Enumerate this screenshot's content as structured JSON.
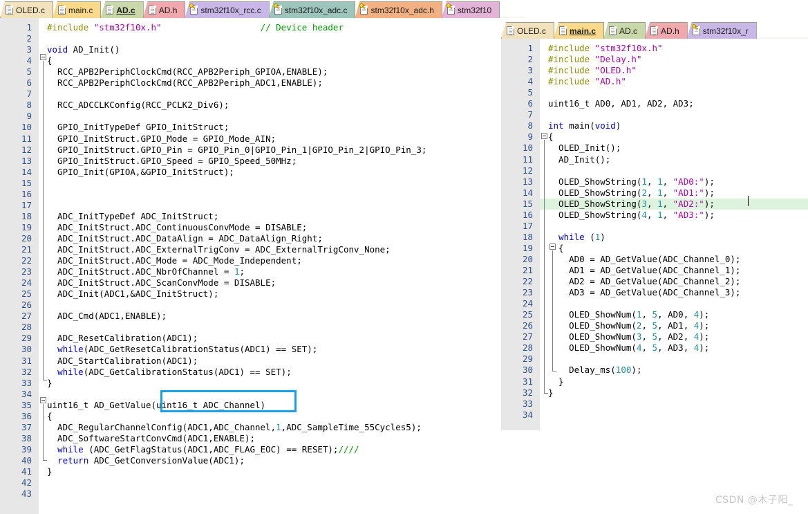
{
  "app": {
    "watermark": "CSDN @木子阳_"
  },
  "left_panel": {
    "tabs": [
      {
        "label": "OLED.c",
        "icon": "file-icon",
        "color": "#f2e2bb",
        "active": false
      },
      {
        "label": "main.c",
        "icon": "file-icon",
        "color": "#fbd98a",
        "active": false
      },
      {
        "label": "AD.c",
        "icon": "file-icon",
        "color": "#c9d8a8",
        "active": true
      },
      {
        "label": "AD.h",
        "icon": "file-icon",
        "color": "#f0a8ac",
        "active": false
      },
      {
        "label": "stm32f10x_rcc.c",
        "icon": "file-key-icon",
        "color": "#c9b7e8",
        "active": false
      },
      {
        "label": "stm32f10x_adc.c",
        "icon": "file-key-icon",
        "color": "#9ec5bb",
        "active": false
      },
      {
        "label": "stm32f10x_adc.h",
        "icon": "file-key-icon",
        "color": "#f2b183",
        "active": false
      },
      {
        "label": "stm32f10",
        "icon": "file-key-icon",
        "color": "#e3b4d8",
        "active": false
      }
    ],
    "lines": [
      {
        "n": "1",
        "tokens": [
          {
            "t": "#include ",
            "c": "pp"
          },
          {
            "t": "\"stm32f10x.h\"",
            "c": "str"
          },
          {
            "t": "                   ",
            "c": "pl"
          },
          {
            "t": "// Device header",
            "c": "cmt"
          }
        ]
      },
      {
        "n": "2",
        "tokens": []
      },
      {
        "n": "3",
        "tokens": [
          {
            "t": "void",
            "c": "kw"
          },
          {
            "t": " AD_Init()",
            "c": "pl"
          }
        ]
      },
      {
        "n": "4",
        "tokens": [
          {
            "t": "{",
            "c": "pl"
          }
        ]
      },
      {
        "n": "5",
        "tokens": [
          {
            "t": "  RCC_APB2PeriphClockCmd(RCC_APB2Periph_GPIOA,ENABLE);",
            "c": "pl"
          }
        ]
      },
      {
        "n": "6",
        "tokens": [
          {
            "t": "  RCC_APB2PeriphClockCmd(RCC_APB2Periph_ADC1,ENABLE);",
            "c": "pl"
          }
        ]
      },
      {
        "n": "7",
        "tokens": []
      },
      {
        "n": "8",
        "tokens": [
          {
            "t": "  RCC_ADCCLKConfig(RCC_PCLK2_Div6);",
            "c": "pl"
          }
        ]
      },
      {
        "n": "9",
        "tokens": []
      },
      {
        "n": "10",
        "tokens": [
          {
            "t": "  GPIO_InitTypeDef GPIO_InitStruct;",
            "c": "pl"
          }
        ]
      },
      {
        "n": "11",
        "tokens": [
          {
            "t": "  GPIO_InitStruct.GPIO_Mode = GPIO_Mode_AIN;",
            "c": "pl"
          }
        ]
      },
      {
        "n": "12",
        "tokens": [
          {
            "t": "  GPIO_InitStruct.GPIO_Pin = GPIO_Pin_0|GPIO_Pin_1|GPIO_Pin_2|GPIO_Pin_3;",
            "c": "pl"
          }
        ]
      },
      {
        "n": "13",
        "tokens": [
          {
            "t": "  GPIO_InitStruct.GPIO_Speed = GPIO_Speed_50MHz;",
            "c": "pl"
          }
        ]
      },
      {
        "n": "14",
        "tokens": [
          {
            "t": "  GPIO_Init(GPIOA,&GPIO_InitStruct);",
            "c": "pl"
          }
        ]
      },
      {
        "n": "15",
        "tokens": []
      },
      {
        "n": "16",
        "tokens": []
      },
      {
        "n": "17",
        "tokens": []
      },
      {
        "n": "18",
        "tokens": [
          {
            "t": "  ADC_InitTypeDef ADC_InitStruct;",
            "c": "pl"
          }
        ]
      },
      {
        "n": "19",
        "tokens": [
          {
            "t": "  ADC_InitStruct.ADC_ContinuousConvMode = DISABLE;",
            "c": "pl"
          }
        ]
      },
      {
        "n": "20",
        "tokens": [
          {
            "t": "  ADC_InitStruct.ADC_DataAlign = ADC_DataAlign_Right;",
            "c": "pl"
          }
        ]
      },
      {
        "n": "21",
        "tokens": [
          {
            "t": "  ADC_InitStruct.ADC_ExternalTrigConv = ADC_ExternalTrigConv_None;",
            "c": "pl"
          }
        ]
      },
      {
        "n": "22",
        "tokens": [
          {
            "t": "  ADC_InitStruct.ADC_Mode = ADC_Mode_Independent;",
            "c": "pl"
          }
        ]
      },
      {
        "n": "23",
        "tokens": [
          {
            "t": "  ADC_InitStruct.ADC_NbrOfChannel = ",
            "c": "pl"
          },
          {
            "t": "1",
            "c": "num"
          },
          {
            "t": ";",
            "c": "pl"
          }
        ]
      },
      {
        "n": "24",
        "tokens": [
          {
            "t": "  ADC_InitStruct.ADC_ScanConvMode = DISABLE;",
            "c": "pl"
          }
        ]
      },
      {
        "n": "25",
        "tokens": [
          {
            "t": "  ADC_Init(ADC1,&ADC_InitStruct);",
            "c": "pl"
          }
        ]
      },
      {
        "n": "26",
        "tokens": []
      },
      {
        "n": "27",
        "tokens": [
          {
            "t": "  ADC_Cmd(ADC1,ENABLE);",
            "c": "pl"
          }
        ]
      },
      {
        "n": "28",
        "tokens": []
      },
      {
        "n": "29",
        "tokens": [
          {
            "t": "  ADC_ResetCalibration(ADC1);",
            "c": "pl"
          }
        ]
      },
      {
        "n": "30",
        "tokens": [
          {
            "t": "  ",
            "c": "pl"
          },
          {
            "t": "while",
            "c": "kw"
          },
          {
            "t": "(ADC_GetResetCalibrationStatus(ADC1) == SET);",
            "c": "pl"
          }
        ]
      },
      {
        "n": "31",
        "tokens": [
          {
            "t": "  ADC_StartCalibration(ADC1);",
            "c": "pl"
          }
        ]
      },
      {
        "n": "32",
        "tokens": [
          {
            "t": "  ",
            "c": "pl"
          },
          {
            "t": "while",
            "c": "kw"
          },
          {
            "t": "(ADC_GetCalibrationStatus(ADC1) == SET);",
            "c": "pl"
          }
        ]
      },
      {
        "n": "33",
        "tokens": [
          {
            "t": "}",
            "c": "pl"
          }
        ]
      },
      {
        "n": "34",
        "tokens": []
      },
      {
        "n": "35",
        "tokens": [
          {
            "t": "uint16_t AD_GetValue(uint16_t ADC_Channel)",
            "c": "pl"
          }
        ]
      },
      {
        "n": "36",
        "tokens": [
          {
            "t": "{",
            "c": "pl"
          }
        ]
      },
      {
        "n": "37",
        "tokens": [
          {
            "t": "  ADC_RegularChannelConfig(ADC1,ADC_Channel,",
            "c": "pl"
          },
          {
            "t": "1",
            "c": "num"
          },
          {
            "t": ",ADC_SampleTime_55Cycles5);",
            "c": "pl"
          }
        ]
      },
      {
        "n": "38",
        "tokens": [
          {
            "t": "  ADC_SoftwareStartConvCmd(ADC1,ENABLE);",
            "c": "pl"
          }
        ]
      },
      {
        "n": "39",
        "tokens": [
          {
            "t": "  ",
            "c": "pl"
          },
          {
            "t": "while",
            "c": "kw"
          },
          {
            "t": " (ADC_GetFlagStatus(ADC1,ADC_FLAG_EOC) == RESET);",
            "c": "pl"
          },
          {
            "t": "////",
            "c": "cmt"
          }
        ]
      },
      {
        "n": "40",
        "tokens": [
          {
            "t": "  ",
            "c": "pl"
          },
          {
            "t": "return",
            "c": "kw"
          },
          {
            "t": " ADC_GetConversionValue(ADC1);",
            "c": "pl"
          }
        ]
      },
      {
        "n": "41",
        "tokens": [
          {
            "t": "}",
            "c": "pl"
          }
        ]
      },
      {
        "n": "42",
        "tokens": []
      },
      {
        "n": "43",
        "tokens": []
      }
    ],
    "annotation": {
      "name": "parameter-highlight-box",
      "color": "#1ba1e2"
    }
  },
  "right_panel": {
    "tabs": [
      {
        "label": "OLED.c",
        "icon": "file-icon",
        "color": "#f2e2bb",
        "active": false
      },
      {
        "label": "main.c",
        "icon": "file-icon",
        "color": "#fbd98a",
        "active": true
      },
      {
        "label": "AD.c",
        "icon": "file-icon",
        "color": "#c9d8a8",
        "active": false
      },
      {
        "label": "AD.h",
        "icon": "file-icon",
        "color": "#f0a8ac",
        "active": false
      },
      {
        "label": "stm32f10x_r",
        "icon": "file-key-icon",
        "color": "#c9b7e8",
        "active": false
      }
    ],
    "highlight_line": 15,
    "highlight_color": "#ddf3dd",
    "lines": [
      {
        "n": "1",
        "tokens": [
          {
            "t": "#include ",
            "c": "pp"
          },
          {
            "t": "\"stm32f10x.h\"",
            "c": "str"
          }
        ]
      },
      {
        "n": "2",
        "tokens": [
          {
            "t": "#include ",
            "c": "pp"
          },
          {
            "t": "\"Delay.h\"",
            "c": "str"
          }
        ]
      },
      {
        "n": "3",
        "tokens": [
          {
            "t": "#include ",
            "c": "pp"
          },
          {
            "t": "\"OLED.h\"",
            "c": "str"
          }
        ]
      },
      {
        "n": "4",
        "tokens": [
          {
            "t": "#include ",
            "c": "pp"
          },
          {
            "t": "\"AD.h\"",
            "c": "str"
          }
        ]
      },
      {
        "n": "5",
        "tokens": []
      },
      {
        "n": "6",
        "tokens": [
          {
            "t": "uint16_t AD0, AD1, AD2, AD3;",
            "c": "pl"
          }
        ]
      },
      {
        "n": "7",
        "tokens": []
      },
      {
        "n": "8",
        "tokens": [
          {
            "t": "int",
            "c": "kw"
          },
          {
            "t": " main(",
            "c": "pl"
          },
          {
            "t": "void",
            "c": "kw"
          },
          {
            "t": ")",
            "c": "pl"
          }
        ]
      },
      {
        "n": "9",
        "tokens": [
          {
            "t": "{",
            "c": "pl"
          }
        ]
      },
      {
        "n": "10",
        "tokens": [
          {
            "t": "  OLED_Init();",
            "c": "pl"
          }
        ]
      },
      {
        "n": "11",
        "tokens": [
          {
            "t": "  AD_Init();",
            "c": "pl"
          }
        ]
      },
      {
        "n": "12",
        "tokens": []
      },
      {
        "n": "13",
        "tokens": [
          {
            "t": "  OLED_ShowString(",
            "c": "pl"
          },
          {
            "t": "1",
            "c": "num"
          },
          {
            "t": ", ",
            "c": "pl"
          },
          {
            "t": "1",
            "c": "num"
          },
          {
            "t": ", ",
            "c": "pl"
          },
          {
            "t": "\"AD0:\"",
            "c": "str"
          },
          {
            "t": ");",
            "c": "pl"
          }
        ]
      },
      {
        "n": "14",
        "tokens": [
          {
            "t": "  OLED_ShowString(",
            "c": "pl"
          },
          {
            "t": "2",
            "c": "num"
          },
          {
            "t": ", ",
            "c": "pl"
          },
          {
            "t": "1",
            "c": "num"
          },
          {
            "t": ", ",
            "c": "pl"
          },
          {
            "t": "\"AD1:\"",
            "c": "str"
          },
          {
            "t": ");",
            "c": "pl"
          }
        ]
      },
      {
        "n": "15",
        "tokens": [
          {
            "t": "  OLED_ShowString(",
            "c": "pl"
          },
          {
            "t": "3",
            "c": "num"
          },
          {
            "t": ", ",
            "c": "pl"
          },
          {
            "t": "1",
            "c": "num"
          },
          {
            "t": ", ",
            "c": "pl"
          },
          {
            "t": "\"AD2:\"",
            "c": "str"
          },
          {
            "t": ");",
            "c": "pl"
          }
        ]
      },
      {
        "n": "16",
        "tokens": [
          {
            "t": "  OLED_ShowString(",
            "c": "pl"
          },
          {
            "t": "4",
            "c": "num"
          },
          {
            "t": ", ",
            "c": "pl"
          },
          {
            "t": "1",
            "c": "num"
          },
          {
            "t": ", ",
            "c": "pl"
          },
          {
            "t": "\"AD3:\"",
            "c": "str"
          },
          {
            "t": ");",
            "c": "pl"
          }
        ]
      },
      {
        "n": "17",
        "tokens": []
      },
      {
        "n": "18",
        "tokens": [
          {
            "t": "  ",
            "c": "pl"
          },
          {
            "t": "while",
            "c": "kw"
          },
          {
            "t": " (",
            "c": "pl"
          },
          {
            "t": "1",
            "c": "num"
          },
          {
            "t": ")",
            "c": "pl"
          }
        ]
      },
      {
        "n": "19",
        "tokens": [
          {
            "t": "  {",
            "c": "pl"
          }
        ]
      },
      {
        "n": "20",
        "tokens": [
          {
            "t": "    AD0 = AD_GetValue(ADC_Channel_0);",
            "c": "pl"
          }
        ]
      },
      {
        "n": "21",
        "tokens": [
          {
            "t": "    AD1 = AD_GetValue(ADC_Channel_1);",
            "c": "pl"
          }
        ]
      },
      {
        "n": "22",
        "tokens": [
          {
            "t": "    AD2 = AD_GetValue(ADC_Channel_2);",
            "c": "pl"
          }
        ]
      },
      {
        "n": "23",
        "tokens": [
          {
            "t": "    AD3 = AD_GetValue(ADC_Channel_3);",
            "c": "pl"
          }
        ]
      },
      {
        "n": "24",
        "tokens": []
      },
      {
        "n": "25",
        "tokens": [
          {
            "t": "    OLED_ShowNum(",
            "c": "pl"
          },
          {
            "t": "1",
            "c": "num"
          },
          {
            "t": ", ",
            "c": "pl"
          },
          {
            "t": "5",
            "c": "num"
          },
          {
            "t": ", AD0, ",
            "c": "pl"
          },
          {
            "t": "4",
            "c": "num"
          },
          {
            "t": ");",
            "c": "pl"
          }
        ]
      },
      {
        "n": "26",
        "tokens": [
          {
            "t": "    OLED_ShowNum(",
            "c": "pl"
          },
          {
            "t": "2",
            "c": "num"
          },
          {
            "t": ", ",
            "c": "pl"
          },
          {
            "t": "5",
            "c": "num"
          },
          {
            "t": ", AD1, ",
            "c": "pl"
          },
          {
            "t": "4",
            "c": "num"
          },
          {
            "t": ");",
            "c": "pl"
          }
        ]
      },
      {
        "n": "27",
        "tokens": [
          {
            "t": "    OLED_ShowNum(",
            "c": "pl"
          },
          {
            "t": "3",
            "c": "num"
          },
          {
            "t": ", ",
            "c": "pl"
          },
          {
            "t": "5",
            "c": "num"
          },
          {
            "t": ", AD2, ",
            "c": "pl"
          },
          {
            "t": "4",
            "c": "num"
          },
          {
            "t": ");",
            "c": "pl"
          }
        ]
      },
      {
        "n": "28",
        "tokens": [
          {
            "t": "    OLED_ShowNum(",
            "c": "pl"
          },
          {
            "t": "4",
            "c": "num"
          },
          {
            "t": ", ",
            "c": "pl"
          },
          {
            "t": "5",
            "c": "num"
          },
          {
            "t": ", AD3, ",
            "c": "pl"
          },
          {
            "t": "4",
            "c": "num"
          },
          {
            "t": ");",
            "c": "pl"
          }
        ]
      },
      {
        "n": "29",
        "tokens": []
      },
      {
        "n": "30",
        "tokens": [
          {
            "t": "    Delay_ms(",
            "c": "pl"
          },
          {
            "t": "100",
            "c": "num"
          },
          {
            "t": ");",
            "c": "pl"
          }
        ]
      },
      {
        "n": "31",
        "tokens": [
          {
            "t": "  }",
            "c": "pl"
          }
        ]
      },
      {
        "n": "32",
        "tokens": [
          {
            "t": "}",
            "c": "pl"
          }
        ]
      },
      {
        "n": "33",
        "tokens": []
      },
      {
        "n": "34",
        "tokens": []
      }
    ]
  }
}
